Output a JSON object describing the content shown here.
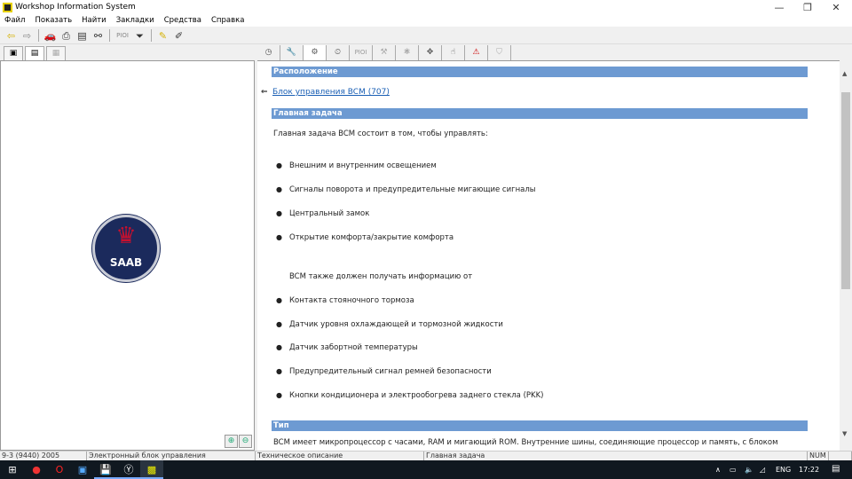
{
  "window": {
    "title": "Workshop Information System"
  },
  "menu": [
    "Файл",
    "Показать",
    "Найти",
    "Закладки",
    "Средства",
    "Справка"
  ],
  "toolbar": {
    "pioi_label": "PIOI"
  },
  "right_tabs": {
    "pioi_label": "PIOI"
  },
  "logo": {
    "text": "SAAB"
  },
  "content": {
    "section_location": "Расположение",
    "location_link": "Блок управления BCM (707)",
    "section_main_task": "Главная задача",
    "intro": "Главная задача BCM состоит в том, чтобы управлять:",
    "controls": [
      "Внешним и внутренним освещением",
      "Сигналы поворота и предупредительные мигающие сигналы",
      "Центральный замок",
      "Открытие комфорта/закрытие комфорта"
    ],
    "inputs_intro": "BCM также должен получать информацию от",
    "inputs": [
      "Контакта стояночного тормоза",
      "Датчик уровня охлаждающей и тормозной жидкости",
      "Датчик забортной температуры",
      "Предупредительный сигнал ремней безопасности",
      "Кнопки кондиционера и электрообогрева заднего стекла (PKK)"
    ],
    "section_type": "Тип",
    "type_text": "BCM имеет микропроцессор с часами, RAM и мигающий ROM. Внутренние шины, соединяющие процессор и память, с блоком"
  },
  "status": {
    "model": "9-3 (9440) 2005",
    "module": "Электронный блок управления",
    "doc": "Техническое описание",
    "section": "Главная задача",
    "num": "NUM"
  },
  "tray": {
    "lang": "ENG",
    "time": "17:22"
  },
  "colors": {
    "header": "#6d9ad2",
    "link": "#1a5fb4",
    "taskbar": "#101820"
  }
}
